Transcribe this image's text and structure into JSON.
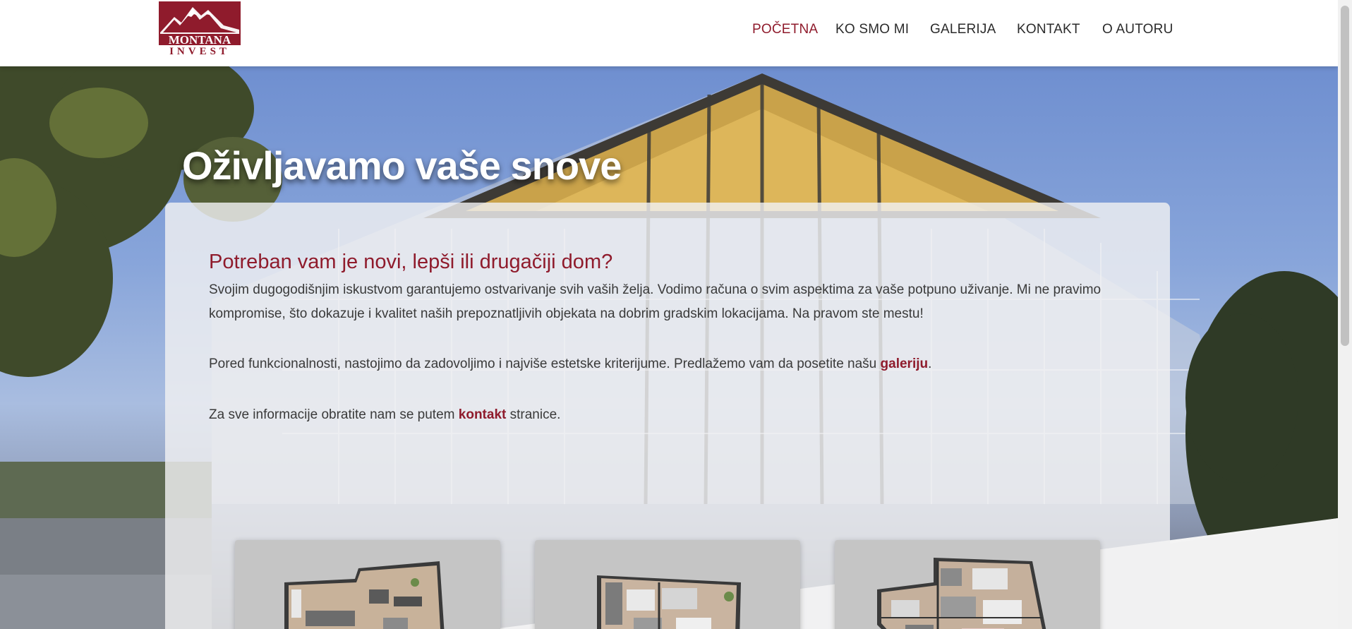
{
  "brand": {
    "logo_line1": "MONTANA",
    "logo_line2": "INVEST",
    "color": "#8f1b2c"
  },
  "nav": {
    "items": [
      {
        "label": "POČETNA",
        "active": true
      },
      {
        "label": "KO SMO MI",
        "active": false
      },
      {
        "label": "GALERIJA",
        "active": false
      },
      {
        "label": "KONTAKT",
        "active": false
      },
      {
        "label": "O AUTORU",
        "active": false
      }
    ]
  },
  "hero": {
    "title": "Oživljavamo vaše snove"
  },
  "content": {
    "heading": "Potreban vam je novi, lepši ili drugačiji dom?",
    "paragraph1": "Svojim dugogodišnjim iskustvom garantujemo ostvarivanje svih vaših želja. Vodimo računa o svim aspektima za vaše potpuno uživanje. Mi ne pravimo kompromise, što dokazuje i kvalitet naših prepoznatljivih objekata na dobrim gradskim lokacijama. Na pravom ste mestu!",
    "paragraph2_before": "Pored funkcionalnosti, nastojimo da zadovoljimo i najviše estetske kriterijume. Predlažemo vam da posetite našu ",
    "paragraph2_link": "galeriju",
    "paragraph2_after": ".",
    "paragraph3_before": "Za sve informacije obratite nam se putem ",
    "paragraph3_link": "kontakt",
    "paragraph3_after": " stranice."
  },
  "cards": [
    {
      "image": "floor-plan-1"
    },
    {
      "image": "floor-plan-2"
    },
    {
      "image": "floor-plan-3"
    }
  ],
  "colors": {
    "accent": "#8f1b2c",
    "text": "#3a3a3a",
    "card_bg": "#c5c5c5"
  }
}
